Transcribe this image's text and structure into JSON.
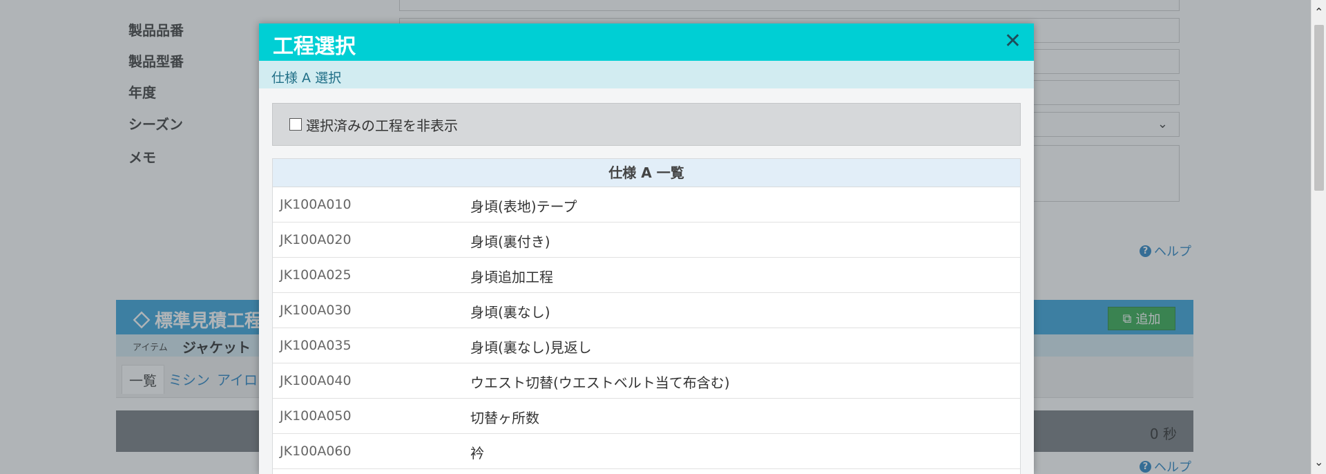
{
  "background": {
    "form_labels": [
      "製品品番",
      "製品型番",
      "年度",
      "シーズン",
      "メモ"
    ],
    "help_label": "ヘルプ",
    "panel_title": "標準見積工程",
    "add_button": "追加",
    "item_label": "アイテム",
    "item_value": "ジャケット",
    "tabs": [
      "一覧",
      "ミシン",
      "アイロン"
    ],
    "total_value": "0 秒"
  },
  "modal": {
    "title": "工程選択",
    "subtitle": "仕様 A 選択",
    "filter_label": "選択済みの工程を非表示",
    "list_header": "仕様 A 一覧",
    "rows": [
      {
        "code": "JK100A010",
        "name": "身頃(表地)テープ"
      },
      {
        "code": "JK100A020",
        "name": "身頃(裏付き)"
      },
      {
        "code": "JK100A025",
        "name": "身頃追加工程"
      },
      {
        "code": "JK100A030",
        "name": "身頃(裏なし)"
      },
      {
        "code": "JK100A035",
        "name": "身頃(裏なし)見返し"
      },
      {
        "code": "JK100A040",
        "name": "ウエスト切替(ウエストベルト当て布含む)"
      },
      {
        "code": "JK100A050",
        "name": "切替ヶ所数"
      },
      {
        "code": "JK100A060",
        "name": "衿"
      }
    ]
  },
  "colors": {
    "modal_header": "#00cfd4",
    "panel_header": "#2f9fd9",
    "add_button": "#28a745"
  }
}
